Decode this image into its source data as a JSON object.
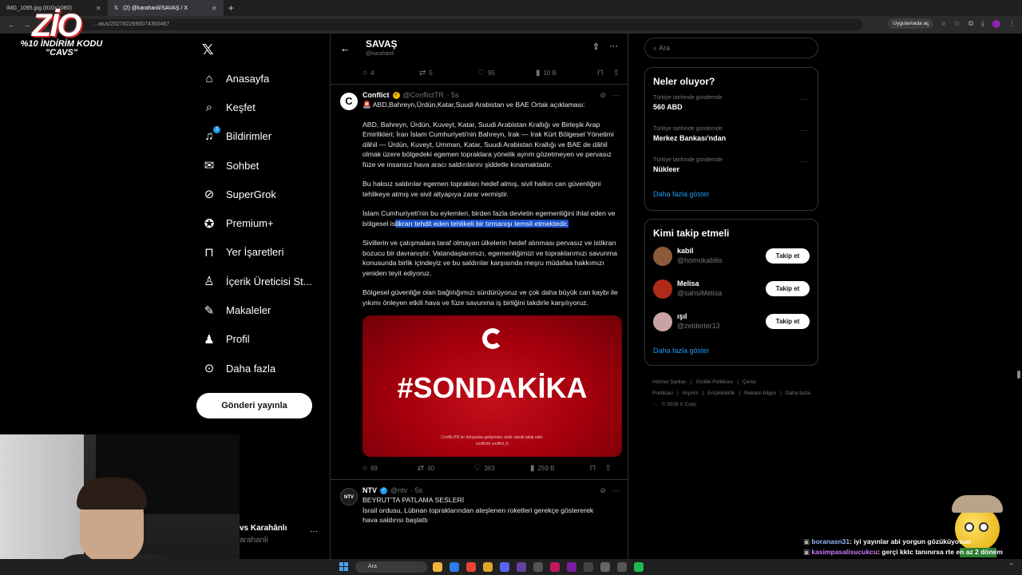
{
  "browser": {
    "tabs": [
      {
        "label": "IMG_1095.jpg (810×1080)",
        "active": false
      },
      {
        "label": "(2) @karahanli/SAVAŞ / X",
        "active": true
      }
    ],
    "url": "…atus/2027822690074300467",
    "open_app_label": "Uygulamada aç"
  },
  "overlay": {
    "logo_text": "ZİO",
    "promo_line1": "%10 İNDİRİM KODU",
    "promo_line2": "\"CAVS\""
  },
  "sidebar": {
    "items": [
      {
        "label": "Anasayfa",
        "icon": "home-icon",
        "glyph": "⌂"
      },
      {
        "label": "Keşfet",
        "icon": "search-icon",
        "glyph": "⌕"
      },
      {
        "label": "Bildirimler",
        "icon": "bell-icon",
        "glyph": "♫",
        "badge": "2"
      },
      {
        "label": "Sohbet",
        "icon": "mail-icon",
        "glyph": "✉"
      },
      {
        "label": "SuperGrok",
        "icon": "grok-icon",
        "glyph": "⊘"
      },
      {
        "label": "Premium+",
        "icon": "premium-icon",
        "glyph": "✪"
      },
      {
        "label": "Yer İşaretleri",
        "icon": "bookmark-icon",
        "glyph": "⊓"
      },
      {
        "label": "İçerik Üreticisi St...",
        "icon": "creator-icon",
        "glyph": "♙"
      },
      {
        "label": "Makaleler",
        "icon": "article-icon",
        "glyph": "✎"
      },
      {
        "label": "Profil",
        "icon": "profile-icon",
        "glyph": "♟"
      },
      {
        "label": "Daha fazla",
        "icon": "more-icon",
        "glyph": "⊙"
      }
    ],
    "post_button": "Gönderi yayınla",
    "account_name": "vs Karahânlı",
    "account_handle": "arahanli"
  },
  "main": {
    "header_title": "SAVAŞ",
    "header_sub": "@karahanli",
    "prev_actions": {
      "replies": "4",
      "reposts": "5",
      "likes": "95",
      "views": "10 B"
    },
    "post1": {
      "name": "Conflict",
      "handle": "@ConflictTR",
      "time": "· 5s",
      "headline": "🚨 ABD,Bahreyn,Ürdün,Katar,Suudi Arabistan ve BAE Ortak açıklaması:",
      "para1": "ABD, Bahreyn, Ürdün, Kuveyt, Katar, Suudi Arabistan Krallığı ve Birleşik Arap Emirlikleri; İran İslam Cumhuriyeti'nin Bahreyn, Irak — Irak Kürt Bölgesel Yönetimi dâhil — Ürdün, Kuveyt, Umman, Katar, Suudi Arabistan Krallığı ve BAE de dâhil olmak üzere bölgedeki egemen topraklara yönelik ayrım gözetmeyen ve pervasız füze ve insansız hava aracı saldırılarını şiddetle kınamaktadır.",
      "para2": "Bu haksız saldırılar egemen toprakları hedef almış, sivil halkın can güvenliğini tehlikeye atmış ve sivil altyapıya zarar vermiştir.",
      "para3_a": "İslam Cumhuriyeti'nin bu eylemleri, birden fazla devletin egemenliğini ihlal eden ve bölgesel is",
      "para3_hl": "tikrarı tehdit eden tehlikeli bir tırmanışı temsil etmektedir.",
      "para4": "Sivillerin ve çatışmalara taraf olmayan ülkelerin hedef alınması pervasız ve istikrarı bozucu bir davranıştır. Vatandaşlarımızı, egemenliğimizi ve topraklarımızı savunma konusunda birlik içindeyiz ve bu saldırılar karşısında meşru müdafaa hakkımızı yeniden teyit ediyoruz.",
      "para5": "Bölgesel güvenliğe olan bağlılığımızı sürdürüyoruz ve çok daha büyük can kaybı ile yıkımı önleyen etkili hava ve füze savunma iş birliğini takdirle karşılıyoruz.",
      "media_tag": "#SONDAKİKA",
      "media_foot": "ConflictTR ile dünyadan gelişmeler anlık olarak takip edin.",
      "media_foot2": "conflicttr   conflict_tr",
      "actions": {
        "replies": "99",
        "reposts": "40",
        "likes": "363",
        "views": "259 B"
      }
    },
    "post2": {
      "name": "NTV",
      "handle": "@ntv",
      "time": "· 5s",
      "line1": "BEYRUT'TA PATLAMA SESLERİ",
      "line2": "İsrail ordusu, Lübnan topraklarından ateşlenen roketleri gerekçe göstererek",
      "line3": "hava saldırısı başlattı"
    }
  },
  "right": {
    "search_placeholder": "Ara",
    "trends_title": "Neler oluyor?",
    "trends": [
      {
        "context": "Türkiye tarihinde gündemde",
        "topic": "560 ABD"
      },
      {
        "context": "Türkiye tarihinde gündemde",
        "topic": "Merkez Bankası'ndan"
      },
      {
        "context": "Türkiye tarihinde gündemde",
        "topic": "Nükleer"
      }
    ],
    "trends_more": "Daha fazla göster",
    "who_title": "Kimi takip etmeli",
    "who": [
      {
        "name": "kabil",
        "handle": "@homokabilis",
        "color": "#8a5a3a"
      },
      {
        "name": "Melisa",
        "handle": "@sahsiMelisa",
        "color": "#b02a1a"
      },
      {
        "name": "ışıl",
        "handle": "@zelderler13",
        "color": "#c9a3a3"
      }
    ],
    "follow_label": "Takip et",
    "who_more": "Daha fazla göster",
    "footer": [
      "Hizmet Şartları",
      "|",
      "Gizlilik Politikası",
      "|",
      "Çerez Politikası",
      "|",
      "Imprint",
      "|",
      "Erişilebilirlik",
      "|",
      "Reklam bilgisi",
      "|",
      "Daha fazla ···",
      "© 2026 X Corp."
    ]
  },
  "chat": [
    {
      "user": "boranasn31",
      "text": ": iyi yayınlar abi yorgun gözüküyosun"
    },
    {
      "user": "kasimpasalisucukcu",
      "text": ": gerçi kktc tanınırsa rte en az 2 dönem daha seçilir"
    }
  ],
  "taskbar": {
    "search_placeholder": "Ara"
  }
}
